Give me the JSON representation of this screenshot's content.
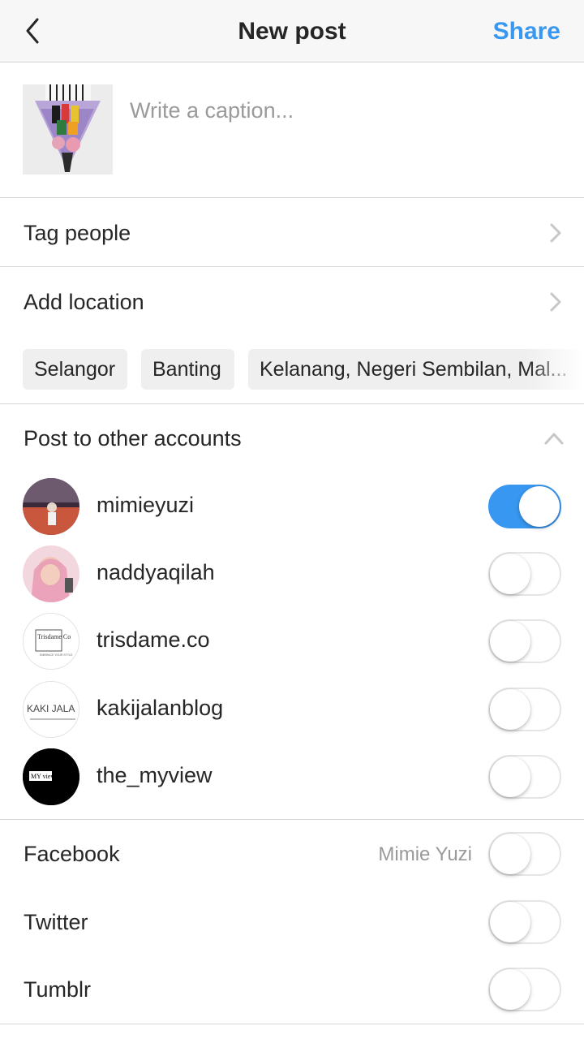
{
  "header": {
    "title": "New post",
    "share_label": "Share"
  },
  "caption": {
    "placeholder": "Write a caption..."
  },
  "tag_people": {
    "label": "Tag people"
  },
  "add_location": {
    "label": "Add location"
  },
  "location_suggestions": [
    "Selangor",
    "Banting",
    "Kelanang, Negeri Sembilan, Mal..."
  ],
  "other_accounts": {
    "title": "Post to other accounts",
    "accounts": [
      {
        "username": "mimieyuzi",
        "enabled": true
      },
      {
        "username": "naddyaqilah",
        "enabled": false
      },
      {
        "username": "trisdame.co",
        "enabled": false
      },
      {
        "username": "kakijalanblog",
        "enabled": false
      },
      {
        "username": "the_myview",
        "enabled": false
      }
    ],
    "avatar_text": {
      "trisdame": "Trisdame Co",
      "trisdame_sub": "EMBRACE YOUR STYLE",
      "kakijalan": "KAKI JALA",
      "myview": "MY view"
    }
  },
  "social": {
    "facebook": {
      "label": "Facebook",
      "account": "Mimie Yuzi",
      "enabled": false
    },
    "twitter": {
      "label": "Twitter",
      "enabled": false
    },
    "tumblr": {
      "label": "Tumblr",
      "enabled": false
    }
  },
  "colors": {
    "accent": "#3897f0",
    "text": "#262626",
    "muted": "#999999",
    "divider": "#d6d6d6"
  }
}
